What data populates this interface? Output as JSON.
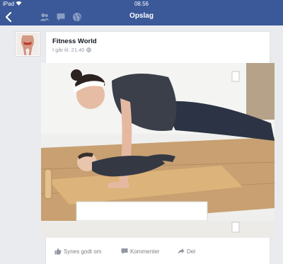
{
  "status_bar": {
    "carrier": "iPad",
    "time": "08.56"
  },
  "nav": {
    "title": "Opslag"
  },
  "post": {
    "page_name": "Fitness World",
    "timestamp": "I går kl. 21.40"
  },
  "actions": {
    "like": "Synes godt om",
    "comment": "Kommenter",
    "share": "Del"
  },
  "colors": {
    "brand": "#3b5998",
    "background": "#e9ebee"
  }
}
